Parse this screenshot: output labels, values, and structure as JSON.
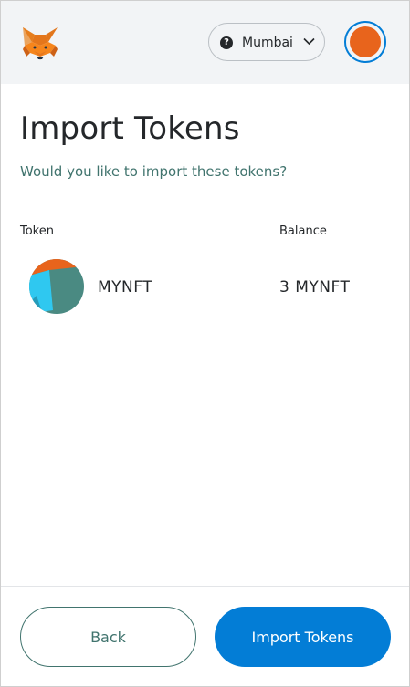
{
  "header": {
    "logo_icon": "metamask-fox-icon",
    "network": {
      "label": "Mumbai",
      "status_icon": "question-icon",
      "chevron_icon": "chevron-down-icon"
    },
    "account_avatar": {
      "color": "#e8641c",
      "ring_color": "#037dd6"
    }
  },
  "page": {
    "title": "Import Tokens",
    "subtitle": "Would you like to import these tokens?"
  },
  "table": {
    "columns": [
      "Token",
      "Balance"
    ],
    "rows": [
      {
        "icon": "identicon-icon",
        "symbol": "MYNFT",
        "balance": "3 MYNFT"
      }
    ]
  },
  "footer": {
    "back_label": "Back",
    "import_label": "Import Tokens"
  },
  "colors": {
    "primary": "#037dd6",
    "secondary_text": "#41746e",
    "header_bg": "#f2f4f6"
  }
}
